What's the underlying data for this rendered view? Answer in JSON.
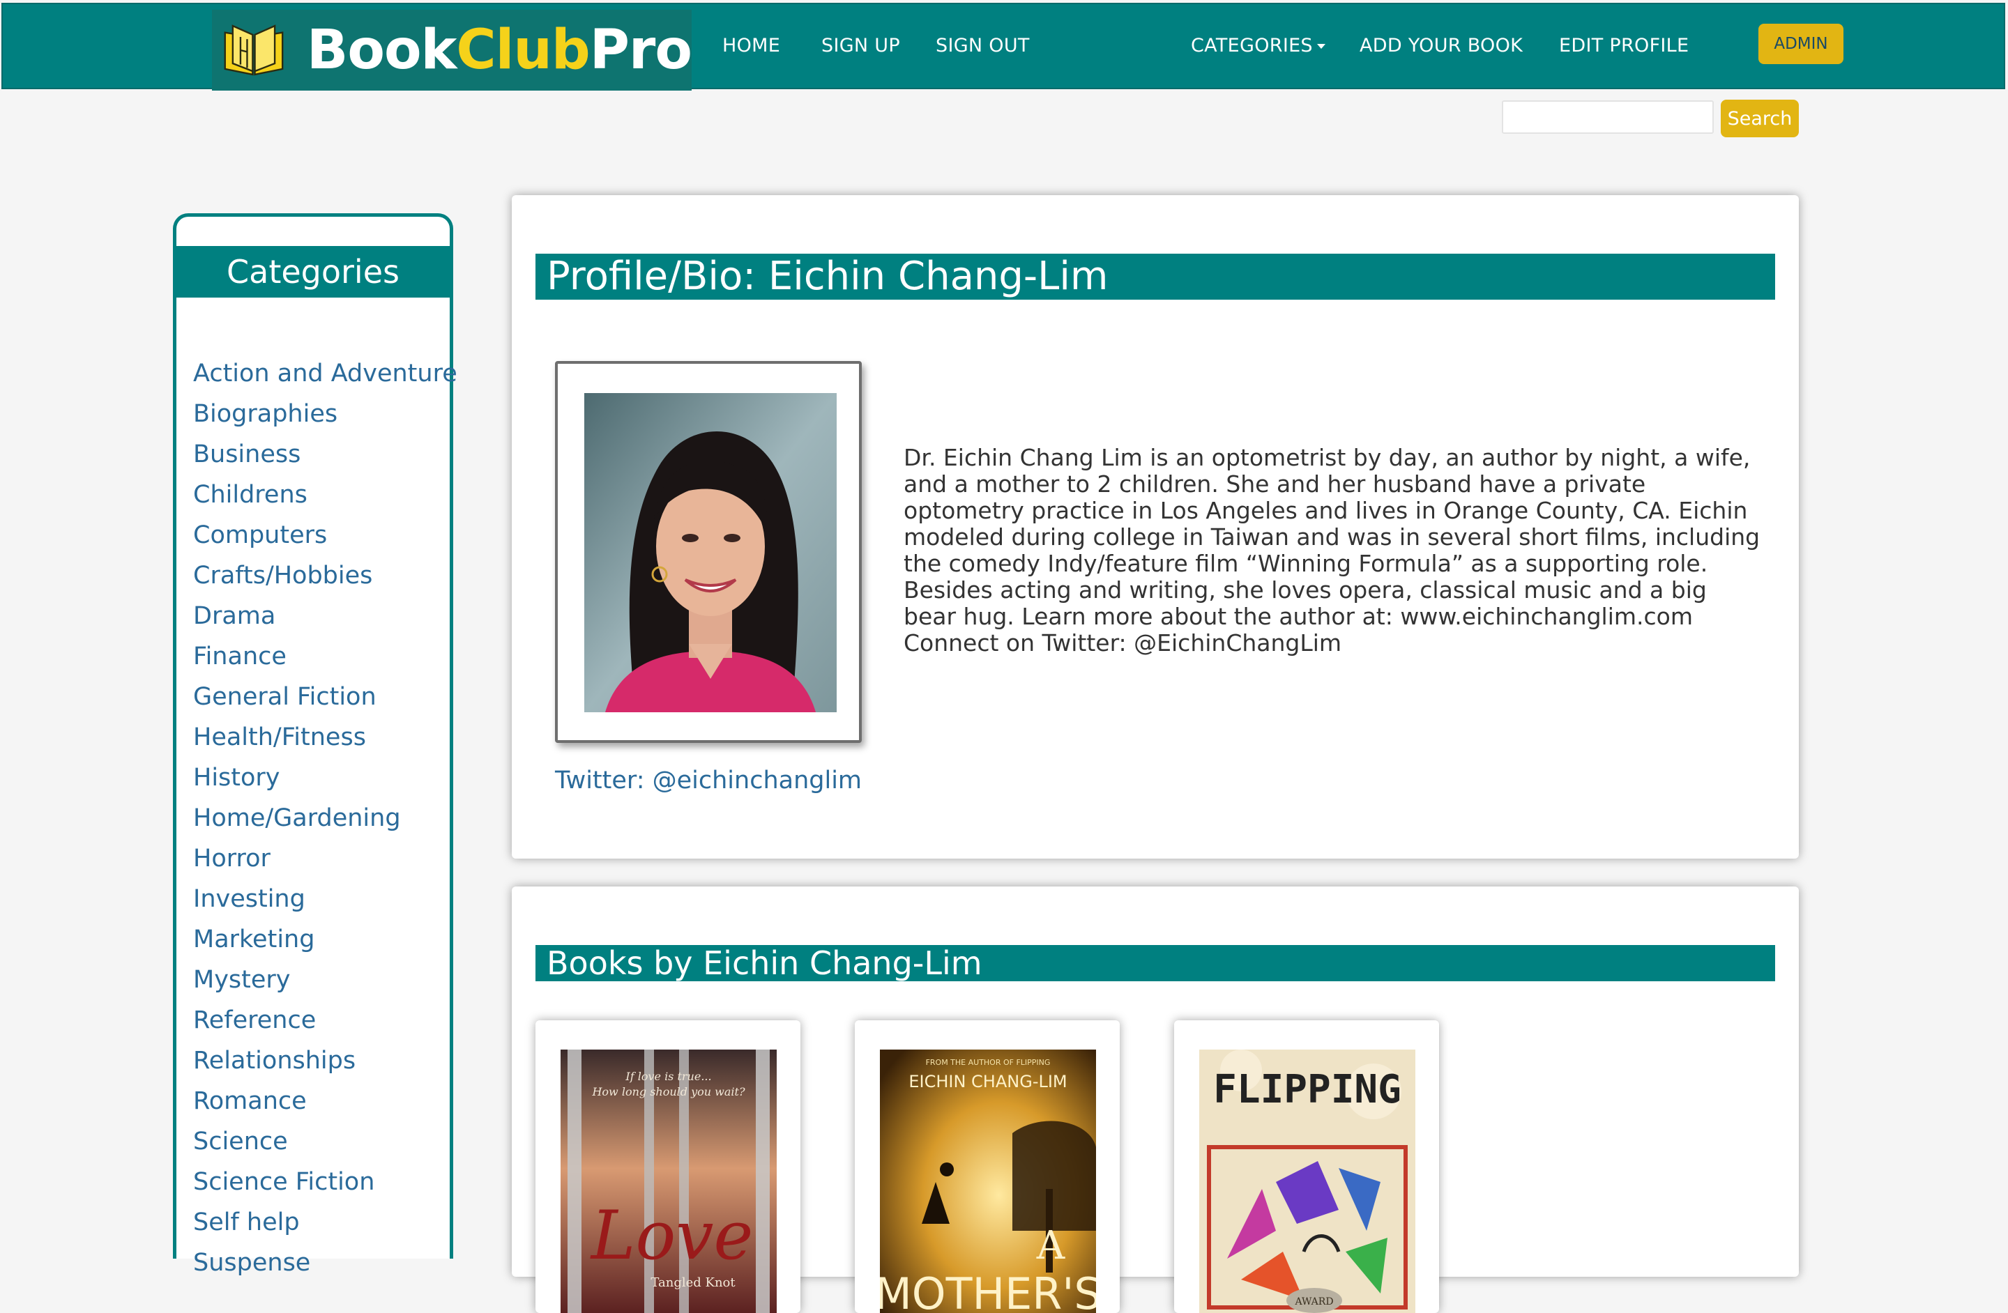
{
  "brand": {
    "part1": "Book",
    "part2": "Club",
    "part3": "Pro",
    "accent": "#f5d21a"
  },
  "nav": {
    "home": "HOME",
    "sign_up": "SIGN UP",
    "sign_out": "SIGN OUT",
    "categories": "CATEGORIES",
    "add_book": "ADD YOUR BOOK",
    "edit_profile": "EDIT PROFILE",
    "admin": "ADMIN"
  },
  "search": {
    "value": "",
    "button": "Search"
  },
  "sidebar": {
    "title": "Categories",
    "items": [
      "Action and Adventure",
      "Biographies",
      "Business",
      "Childrens",
      "Computers",
      "Crafts/Hobbies",
      "Drama",
      "Finance",
      "General Fiction",
      "Health/Fitness",
      "History",
      "Home/Gardening",
      "Horror",
      "Investing",
      "Marketing",
      "Mystery",
      "Reference",
      "Relationships",
      "Romance",
      "Science",
      "Science Fiction",
      "Self help",
      "Suspense"
    ]
  },
  "profile": {
    "title": "Profile/Bio: Eichin Chang-Lim",
    "twitter": "Twitter: @eichinchanglim",
    "bio": "Dr. Eichin Chang Lim is an optometrist by day, an author by night, a wife, and a mother to 2 children. She and her husband have a private optometry practice in Los Angeles and lives in Orange County, CA. Eichin modeled during college in Taiwan and was in several short films, including the comedy Indy/feature film “Winning Formula” as a supporting role. Besides acting and writing, she loves opera, classical music and a big bear hug. Learn more about the author at: www.eichinchanglim.com Connect on Twitter: @EichinChangLim"
  },
  "books": {
    "title": "Books by Eichin Chang-Lim",
    "covers": {
      "love": {
        "tagline_1": "If love is true...",
        "tagline_2": "How long should you wait?",
        "title": "Love",
        "subtitle": "Tangled Knot"
      },
      "mother": {
        "kicker": "FROM THE AUTHOR OF FLIPPING",
        "author": "EICHIN CHANG-LIM",
        "title_1": "A",
        "title_2": "MOTHER'S"
      },
      "flipping": {
        "title": "FLIPPING",
        "badge": "AWARD"
      }
    }
  },
  "colors": {
    "teal": "#008080",
    "gold": "#e2b513",
    "link": "#2a6a9a"
  }
}
